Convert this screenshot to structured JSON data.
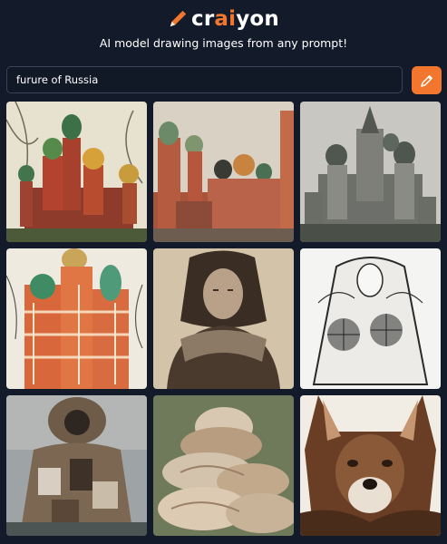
{
  "app": {
    "logo_prefix": "cr",
    "logo_accent": "ai",
    "logo_suffix": "yon",
    "tagline": "AI model drawing images from any prompt!"
  },
  "search": {
    "value": "furure of Russia"
  },
  "draw_button": {
    "icon": "pencil-icon"
  },
  "results": [
    {
      "subject": "onion-dome cathedral painting"
    },
    {
      "subject": "red kremlin towers and cathedral"
    },
    {
      "subject": "grey cathedral photograph"
    },
    {
      "subject": "orange striped domes drawing"
    },
    {
      "subject": "figure in fur hood sepia photo"
    },
    {
      "subject": "ink sketch of veiled woman"
    },
    {
      "subject": "patchwork fur coat"
    },
    {
      "subject": "pile of fur hats"
    },
    {
      "subject": "wolf dog painting"
    }
  ],
  "colors": {
    "background": "#131b2a",
    "accent": "#f2762e",
    "input_border": "#3b4456"
  }
}
